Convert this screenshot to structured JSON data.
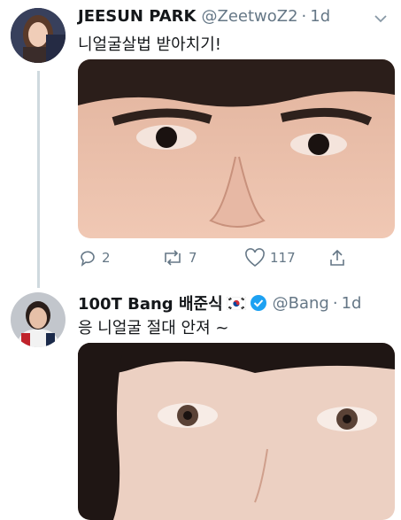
{
  "tweet1": {
    "display_name": "JEESUN PARK",
    "handle": "@ZeetwoZ2",
    "separator": "·",
    "time": "1d",
    "text": "니얼굴살법 받아치기!",
    "replies": "2",
    "retweets": "7",
    "likes": "117"
  },
  "tweet2": {
    "display_name": "100T Bang 배준식",
    "flag": "south-korea-flag",
    "handle": "@Bang",
    "separator": "·",
    "time": "1d",
    "text": "응 니얼굴 절대 안져 ~"
  },
  "colors": {
    "verified": "#1da1f2",
    "secondary_text": "#657786",
    "thread_line": "#cfd9de"
  }
}
